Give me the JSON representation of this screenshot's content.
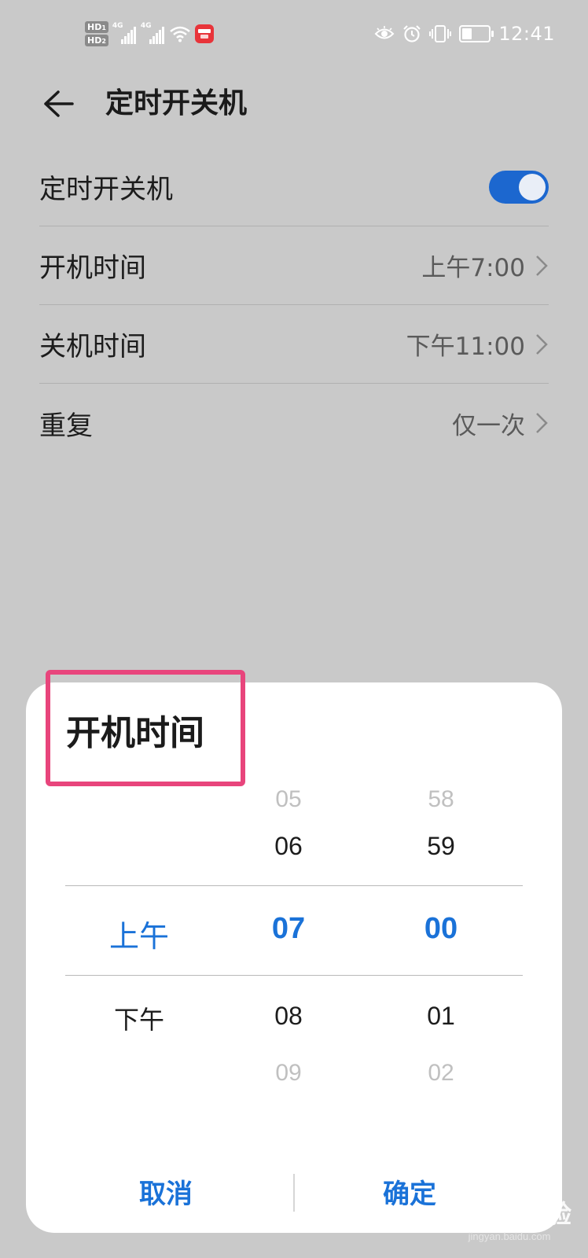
{
  "status_bar": {
    "hd1": "HD",
    "sim1": "1",
    "hd2": "HD",
    "sim2": "2",
    "net1": "4G",
    "net2": "4G",
    "time": "12:41",
    "icons": [
      "hd-icon",
      "signal-icon",
      "wifi-icon",
      "app-badge-icon",
      "eye-comfort-icon",
      "alarm-icon",
      "vibrate-icon",
      "battery-icon"
    ],
    "battery_level": 0.35
  },
  "header": {
    "title": "定时开关机"
  },
  "settings": {
    "toggle_label": "定时开关机",
    "toggle_on": true,
    "rows": [
      {
        "label": "开机时间",
        "value": "上午7:00"
      },
      {
        "label": "关机时间",
        "value": "下午11:00"
      },
      {
        "label": "重复",
        "value": "仅一次"
      }
    ]
  },
  "dialog": {
    "title": "开机时间",
    "picker": {
      "ampm": {
        "selected": "上午",
        "next": "下午"
      },
      "hours": {
        "far_prev": "05",
        "prev": "06",
        "selected": "07",
        "next": "08",
        "far_next": "09"
      },
      "minutes": {
        "far_prev": "58",
        "prev": "59",
        "selected": "00",
        "next": "01",
        "far_next": "02"
      }
    },
    "cancel_label": "取消",
    "confirm_label": "确定"
  },
  "watermark": {
    "logo": "Baidu经验",
    "url": "jingyan.baidu.com"
  },
  "colors": {
    "accent": "#1a72d8",
    "toggle": "#1c67cf",
    "highlight_box": "#e8457c",
    "overlay_bg": "#c9c9c9"
  }
}
